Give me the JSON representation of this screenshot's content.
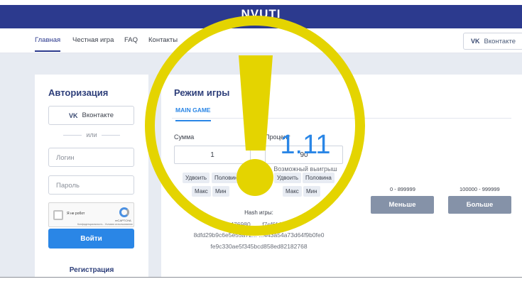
{
  "brand": "NVUTI",
  "nav": {
    "links": [
      "Главная",
      "Честная игра",
      "FAQ",
      "Контакты"
    ],
    "vk_label": "Вконтакте",
    "vk_icon": "vk-icon"
  },
  "auth": {
    "title": "Авторизация",
    "vk_label": "Вконтакте",
    "or": "или",
    "login_placeholder": "Логин",
    "password_placeholder": "Пароль",
    "captcha": {
      "label": "Я не робот",
      "brand": "reCAPTCHA",
      "terms": "Конфиденциальность - Условия использования"
    },
    "submit": "Войти",
    "register": "Регистрация"
  },
  "game": {
    "title": "Режим игры",
    "tab": "MAIN GAME",
    "sum_label": "Сумма",
    "sum_value": "1",
    "percent_label": "Процент",
    "percent_value": "90",
    "sum_buttons": [
      "Удвоить",
      "Половина",
      "Макс",
      "Мин"
    ],
    "percent_buttons": [
      "Удвоить",
      "Половина",
      "Макс",
      "Мин"
    ],
    "multiplier": "1.11",
    "possible_label": "Возможный выигрыш",
    "low_range": "0 - 899999",
    "high_range": "100000 - 999999",
    "less_button": "Меньше",
    "more_button": "Больше",
    "hash_label": "Hash игры:",
    "hash_lines": [
      "1e476980...                           ...f7ef6fd7dd0",
      "8dfd29b9c6e5e55a72...         ...443a54a73d64f9b0fe0",
      "fe9c330ae5f345bcd858ed82182768"
    ]
  },
  "colors": {
    "header": "#2c3a8e",
    "accent": "#2a86e6",
    "overlay": "#e4d400"
  },
  "overlay_icon": "exclamation-warning-icon"
}
